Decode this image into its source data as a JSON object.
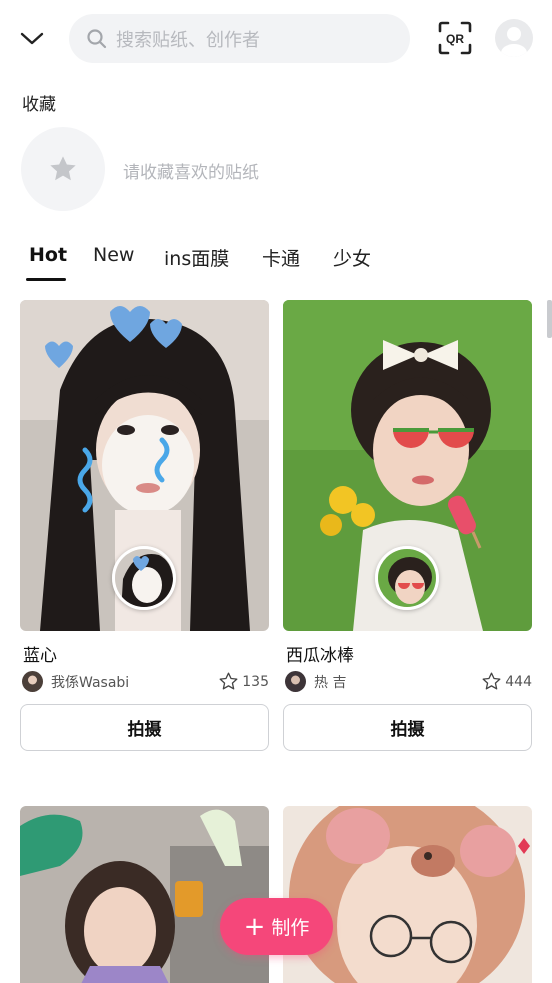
{
  "header": {
    "search_placeholder": "搜索贴纸、创作者",
    "qr_label": "QR"
  },
  "favorites": {
    "title": "收藏",
    "empty_hint": "请收藏喜欢的贴纸"
  },
  "tabs": [
    {
      "label": "Hot",
      "active": true
    },
    {
      "label": "New",
      "active": false
    },
    {
      "label": "ins面膜",
      "active": false
    },
    {
      "label": "卡通",
      "active": false
    },
    {
      "label": "少女",
      "active": false
    }
  ],
  "stickers": [
    {
      "title": "蓝心",
      "author": "我係Wasabi",
      "likes": "135",
      "action": "拍摄"
    },
    {
      "title": "西瓜冰棒",
      "author": "热 吉",
      "likes": "444",
      "action": "拍摄"
    }
  ],
  "fab": {
    "label": "制作",
    "color": "#f5477a"
  }
}
